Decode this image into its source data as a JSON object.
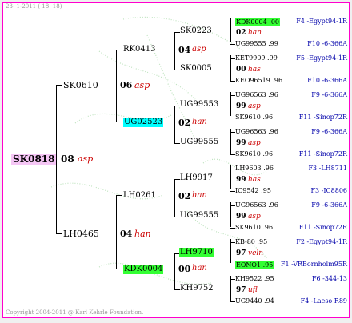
{
  "header": "23- 1-2011 ( 18: 18)",
  "footer": "Copyright 2004-2011 @ Karl Kehrle Foundation.",
  "root": {
    "id": "SK0818",
    "gen": "08",
    "race": "asp"
  },
  "gen1": [
    {
      "id": "SK0610"
    },
    {
      "id": "LH0465",
      "gen": "04",
      "race": "han"
    }
  ],
  "gen1_sk0610": {
    "gen": "06",
    "race": "asp"
  },
  "gen2": [
    {
      "id": "RK0413",
      "gen": "04",
      "race": "asp"
    },
    {
      "id": "UG02523",
      "gen": "02",
      "race": "han"
    },
    {
      "id": "LH0261",
      "gen": "02",
      "race": "han"
    },
    {
      "id": "KDK0004",
      "gen": "00",
      "race": "han"
    }
  ],
  "gen3": [
    {
      "id": "SK0223",
      "gen": "02",
      "race": "han"
    },
    {
      "id": "SK0005",
      "gen": "00",
      "race": "has"
    },
    {
      "id": "UG99553",
      "gen": "99",
      "race": "asp"
    },
    {
      "id": "UG99555",
      "gen": "99",
      "race": "asp"
    },
    {
      "id": "LH9917",
      "gen": "99",
      "race": "has"
    },
    {
      "id": "UG99555",
      "gen": "99",
      "race": "asp"
    },
    {
      "id": "LH9710",
      "gen": "97",
      "race": "veln"
    },
    {
      "id": "KH9752",
      "gen": "97",
      "race": "ufl"
    }
  ],
  "gen4": [
    {
      "id": "KDK0004 .00",
      "info": "F4 -Egypt94-1R"
    },
    {
      "id": "UG99555 .99",
      "info": "F10 -6-366A"
    },
    {
      "id": "KET9909 .99",
      "info": "F5 -Egypt94-1R"
    },
    {
      "id": "KEO96519 .96",
      "info": "F10 -6-366A"
    },
    {
      "id": "UG96563 .96",
      "info": "F9 -6-366A"
    },
    {
      "id": "SK9610 .96",
      "info": "F11 -Sinop72R"
    },
    {
      "id": "UG96563 .96",
      "info": "F9 -6-366A"
    },
    {
      "id": "SK9610 .96",
      "info": "F11 -Sinop72R"
    },
    {
      "id": "LH9603 .96",
      "info": "F3 -LH8711"
    },
    {
      "id": "IC9542 .95",
      "info": "F3 -IC8806"
    },
    {
      "id": "UG96563 .96",
      "info": "F9 -6-366A"
    },
    {
      "id": "SK9610 .96",
      "info": "F11 -Sinop72R"
    },
    {
      "id": "KB-80 .95",
      "info": "F2 -Egypt94-1R"
    },
    {
      "id": "EONO1 .95",
      "info": "F1 -VRBornholm95R"
    },
    {
      "id": "KH9522 .95",
      "info": "F6 -344-13"
    },
    {
      "id": "UG9440 .94",
      "info": "F4 -Laeso R89"
    }
  ]
}
